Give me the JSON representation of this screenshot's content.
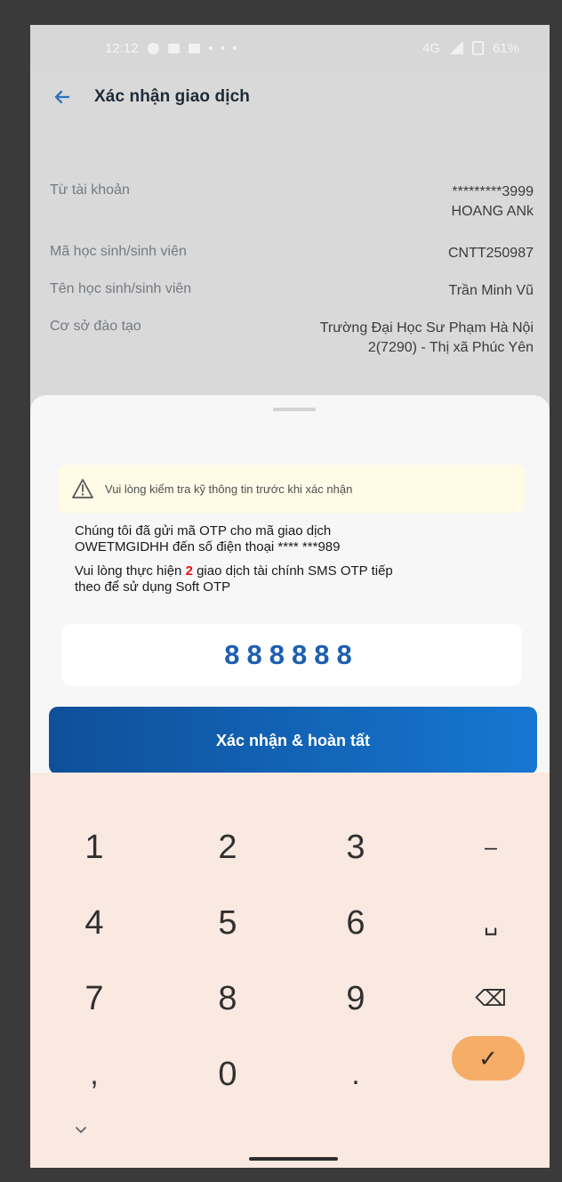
{
  "status_bar": {
    "time": "12:12",
    "battery": "61%",
    "signal": "4G"
  },
  "header": {
    "title": "Xác nhận giao dịch"
  },
  "details": [
    {
      "label": "Từ tài khoản",
      "value": "*********3999\nHOANG ANk"
    },
    {
      "label": "Mã học sinh/sinh viên",
      "value": "CNTT250987"
    },
    {
      "label": "Tên học sinh/sinh viên",
      "value": "Trần Minh Vũ"
    },
    {
      "label": "Cơ sở đào tạo",
      "value": "Trường Đại Học Sư Phạm Hà Nội\n2(7290) - Thị xã Phúc Yên"
    }
  ],
  "warning": {
    "text": "Vui lòng kiểm tra kỹ thông tin trước khi xác nhận"
  },
  "otp": {
    "message_line1": "Chúng tôi đã gửi mã OTP cho mã giao dịch",
    "message_line2": "OWETMGIDHH đến số điện thoại **** ***989",
    "message_line3_prefix": "Vui lòng thực hiện ",
    "message_line3_count": "2",
    "message_line3_suffix": " giao dịch tài chính SMS OTP tiếp",
    "message_line4": "theo để sử dụng Soft OTP",
    "value": "888888"
  },
  "button": {
    "confirm": "Xác nhận & hoàn tất"
  },
  "keyboard": {
    "keys": [
      "1",
      "2",
      "3",
      "–",
      "4",
      "5",
      "6",
      "␣",
      "7",
      "8",
      "9",
      "⌫",
      ",",
      "0",
      ".",
      "✓"
    ]
  },
  "colors": {
    "primary": "#1677d1",
    "warning_bg": "#fffbe7",
    "keyboard_bg": "#fae9e0",
    "accent_orange": "#f6ad68"
  }
}
